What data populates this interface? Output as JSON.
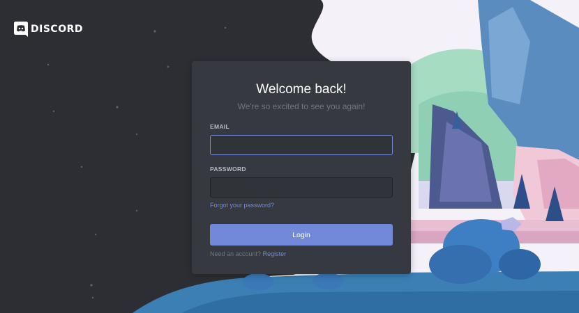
{
  "brand": {
    "logo_icon": "discord-logo-icon",
    "wordmark": "DISCORD"
  },
  "login": {
    "title": "Welcome back!",
    "subtitle": "We're so excited to see you again!",
    "email_label": "EMAIL",
    "email_value": "",
    "password_label": "PASSWORD",
    "password_value": "",
    "forgot_link": "Forgot your password?",
    "submit_label": "Login",
    "need_account_text": "Need an account?",
    "register_link": "Register"
  },
  "colors": {
    "accent": "#7289da",
    "card": "#36393f",
    "background_dark": "#2f3136"
  }
}
